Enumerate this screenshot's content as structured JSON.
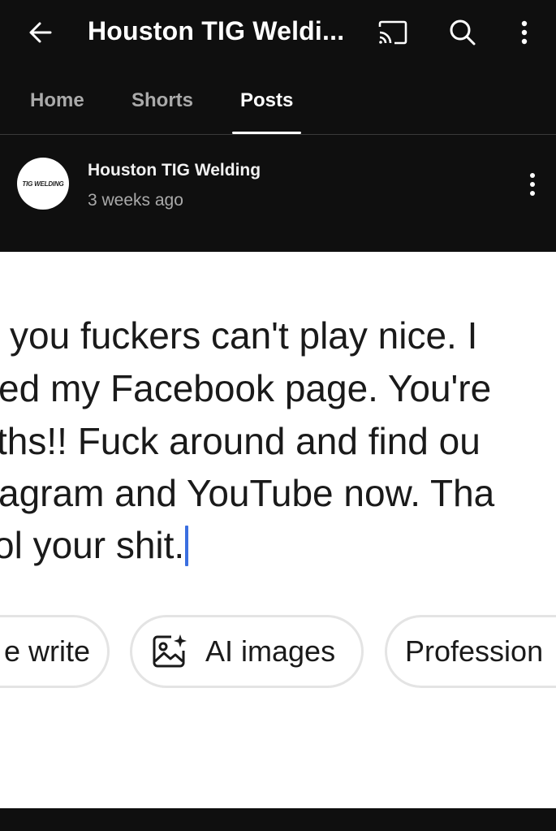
{
  "appbar": {
    "title": "Houston TIG Weldi...",
    "icons": [
      "arrow-back-icon",
      "cast-icon",
      "search-icon",
      "more-vert-icon"
    ]
  },
  "tabs": [
    {
      "label": "Home",
      "active": false
    },
    {
      "label": "Shorts",
      "active": false
    },
    {
      "label": "Posts",
      "active": true
    }
  ],
  "post": {
    "channel_name": "Houston TIG Welding",
    "time": "3 weeks ago",
    "avatar_text": "TIG WELDING"
  },
  "content": {
    "lines": [
      "you fuckers can't play nice. I",
      "ed my Facebook page. You're",
      "ths!! Fuck around and find ou",
      "agram and YouTube now. Tha",
      "ol your shit."
    ],
    "chips": [
      {
        "label": "e write"
      },
      {
        "label": "AI images",
        "icon": "ai-image-icon"
      },
      {
        "label": "Profession"
      }
    ]
  },
  "colors": {
    "background": "#0f0f0f",
    "text_primary": "#ffffff",
    "text_secondary": "#aaaaaa",
    "caret": "#3b6fe0",
    "content_bg": "#ffffff"
  }
}
